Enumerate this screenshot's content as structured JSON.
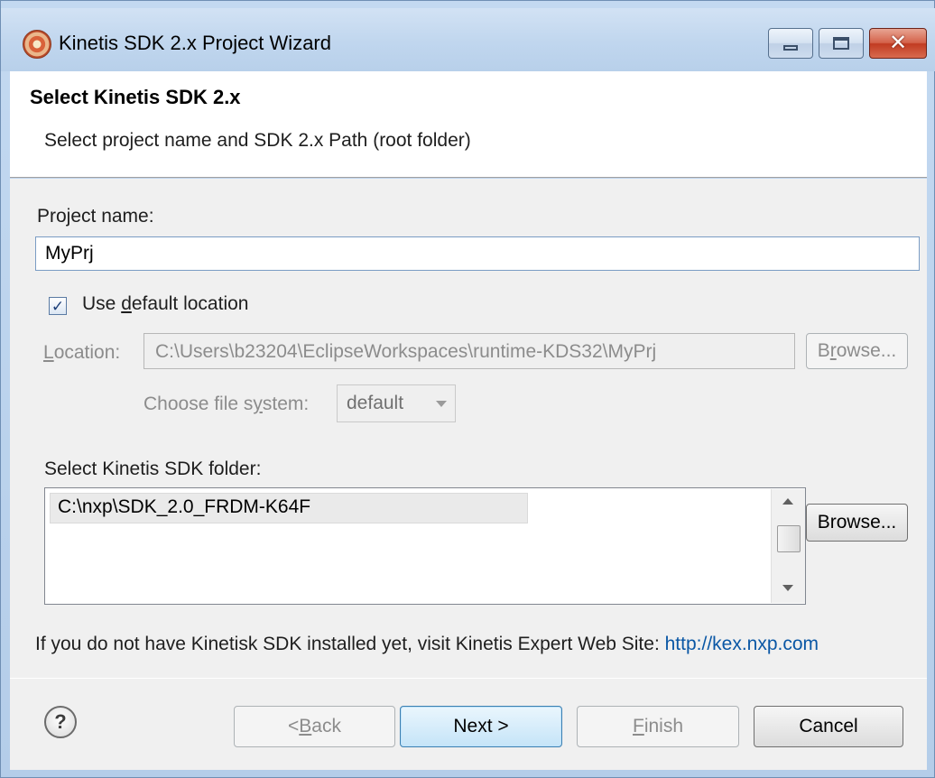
{
  "window": {
    "title": "Kinetis SDK 2.x Project Wizard",
    "icons": {
      "app": "kinetis-app-icon",
      "minimize": "minimize-icon",
      "maximize": "maximize-icon",
      "close": "close-icon"
    }
  },
  "header": {
    "title": "Select Kinetis SDK 2.x",
    "description": "Select project name and SDK 2.x Path (root folder)"
  },
  "project": {
    "label": "Project name:",
    "value": "MyPrj"
  },
  "default_location": {
    "checked": true,
    "label_pre": "Use ",
    "label_accel": "d",
    "label_post": "efault location"
  },
  "location": {
    "label_accel": "L",
    "label_post": "ocation:",
    "value": "C:\\Users\\b23204\\EclipseWorkspaces\\runtime-KDS32\\MyPrj",
    "browse_pre": "B",
    "browse_accel": "r",
    "browse_post": "owse...",
    "enabled": false
  },
  "file_system": {
    "label_pre": "Choose file s",
    "label_accel": "y",
    "label_post": "stem:",
    "selected": "default"
  },
  "sdk_folder": {
    "label": "Select Kinetis SDK folder:",
    "items": [
      "C:\\nxp\\SDK_2.0_FRDM-K64F"
    ],
    "browse_label": "Browse..."
  },
  "info": {
    "text": "If you do not have Kinetisk SDK installed yet, visit Kinetis Expert Web Site: ",
    "link": "http://kex.nxp.com",
    "link_color": "#0a57a5"
  },
  "buttons": {
    "help_icon": "help-icon",
    "back_pre": "< ",
    "back_accel": "B",
    "back_post": "ack",
    "next": "Next >",
    "finish_accel": "F",
    "finish_post": "inish",
    "cancel": "Cancel"
  }
}
